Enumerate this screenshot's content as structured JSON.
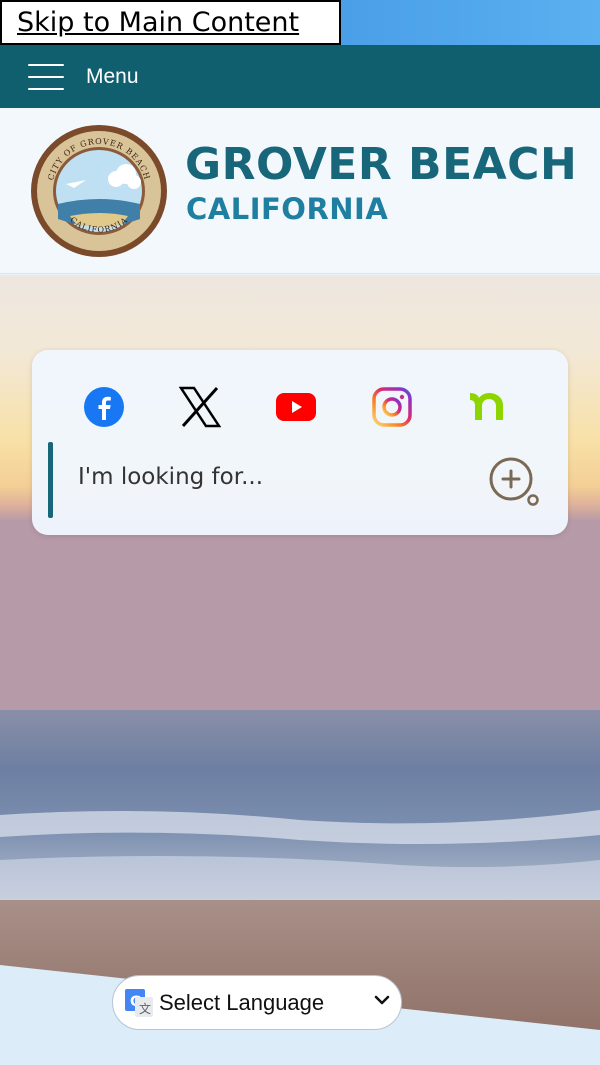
{
  "skip_link": "Skip to Main Content",
  "menu": {
    "label": "Menu"
  },
  "brand": {
    "title": "GROVER BEACH",
    "subtitle": "CALIFORNIA"
  },
  "seal": {
    "top_text": "CITY OF GROVER BEACH",
    "bottom_text": "CALIFORNIA"
  },
  "social": [
    {
      "name": "facebook-icon",
      "color": "#1877f2"
    },
    {
      "name": "x-icon",
      "color": "#000000"
    },
    {
      "name": "youtube-icon",
      "color": "#ff0000"
    },
    {
      "name": "instagram-icon",
      "color": "#c13584"
    },
    {
      "name": "nextdoor-icon",
      "color": "#8ed500"
    }
  ],
  "search": {
    "placeholder": "I'm looking for..."
  },
  "language": {
    "selected": "Select Language"
  },
  "colors": {
    "brand_teal": "#17667a",
    "menu_bar": "#0f5f6e"
  }
}
